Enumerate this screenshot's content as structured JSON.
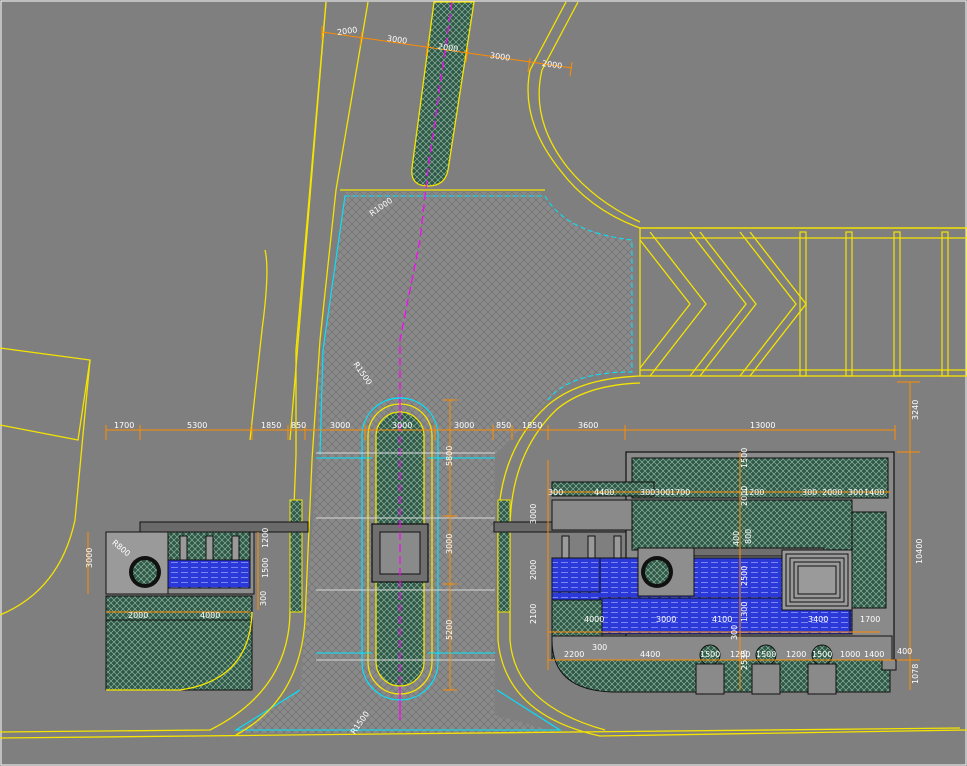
{
  "colors": {
    "background": "#7f7f7f",
    "road_line": "#f5e400",
    "paving_outline": "#00e5ff",
    "dimension": "#ff8c00",
    "planting": "#2f5a4a",
    "water": "#2b39d8",
    "centerline": "#ff00ff"
  },
  "top_dimensions": [
    "2000",
    "3000",
    "2000",
    "3000",
    "2000"
  ],
  "radius_labels": {
    "top_curve": "R1000",
    "upper_island": "R1500",
    "lower_island": "R1500",
    "left_pool": "R800"
  },
  "horizontal_dimensions": [
    "1700",
    "5300",
    "1850",
    "850",
    "3000",
    "3000",
    "3000",
    "850",
    "1850",
    "3600",
    "13000"
  ],
  "right_dim_labels": {
    "top_right": "3240",
    "far_right": "10400",
    "bottom_right_a": "400",
    "bottom_right_b": "1078"
  },
  "island_vertical_labels": [
    "5800",
    "3000",
    "5200"
  ],
  "left_pool_labels": {
    "height": "3000",
    "row_a": "1200",
    "row_b": "1500",
    "row_c": "300",
    "bottom_a": "2000",
    "bottom_b": "4000"
  },
  "right_block_labels": {
    "row1": [
      "300",
      "4400",
      "300",
      "300",
      "1700",
      "1200",
      "300",
      "2000",
      "300",
      "1400"
    ],
    "left_vertical": [
      "3000",
      "2000",
      "2100"
    ],
    "middle_vertical": [
      "1500",
      "2000",
      "400",
      "800",
      "2500",
      "1300",
      "300",
      "2535"
    ],
    "row_pool": [
      "4000",
      "3000",
      "4100",
      "3400",
      "1700"
    ],
    "row_bottom": [
      "2200",
      "300",
      "4400",
      "1500",
      "1200",
      "1500",
      "1200",
      "1500",
      "1000",
      "1400"
    ]
  },
  "pedestrian_stripes": 4,
  "chevrons": 3
}
